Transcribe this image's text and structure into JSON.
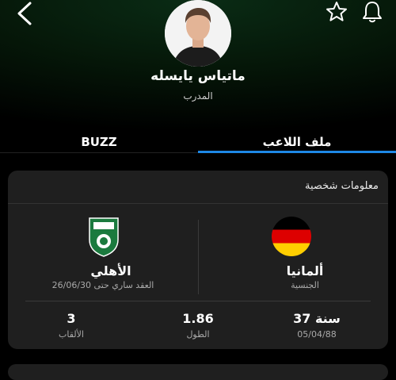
{
  "header": {
    "name": "ماتياس يايسله",
    "role": "المدرب"
  },
  "tabs": {
    "buzz": "BUZZ",
    "profile": "ملف اللاعب"
  },
  "card": {
    "title": "معلومات شخصية",
    "nationality": {
      "value": "ألمانيا",
      "label": "الجنسية"
    },
    "club": {
      "value": "الأهلي",
      "label": "العقد ساري حتى 26/06/30"
    },
    "age": {
      "value": "37 سنة",
      "label": "05/04/88"
    },
    "height": {
      "value": "1.86",
      "label": "الطول"
    },
    "titles": {
      "value": "3",
      "label": "الألقاب"
    }
  },
  "colors": {
    "accent": "#1e88e5",
    "card": "#1f1f1f",
    "club_green": "#1b7a3e"
  },
  "icons": [
    "back-arrow-icon",
    "star-icon",
    "bell-icon",
    "germany-flag-icon",
    "al-ahli-logo-icon"
  ]
}
